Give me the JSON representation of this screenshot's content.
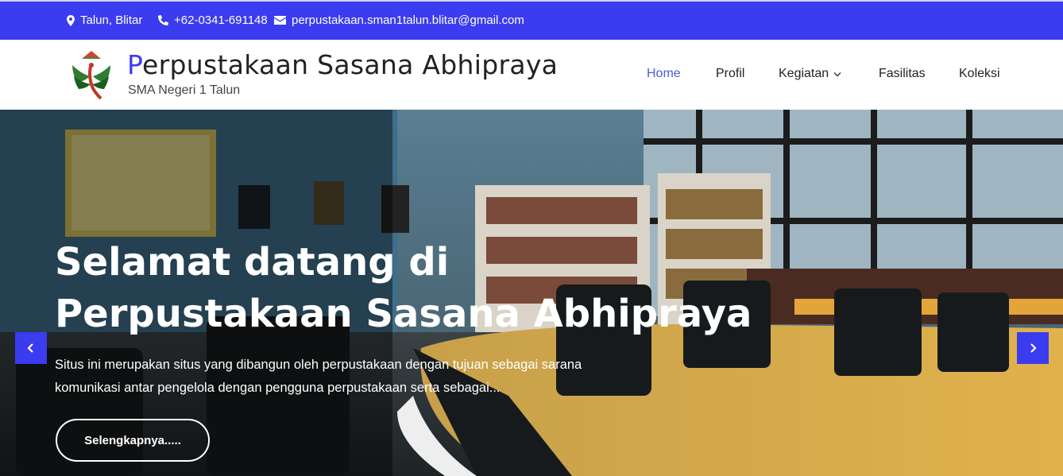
{
  "topbar": {
    "location": "Talun, Blitar",
    "phone": "+62-0341-691148",
    "email": "perpustakaan.sman1talun.blitar@gmail.com"
  },
  "brand": {
    "title_first_letter": "P",
    "title_rest": "erpustakaan Sasana Abhipraya",
    "subtitle": "SMA Negeri 1 Talun"
  },
  "nav": {
    "items": [
      {
        "label": "Home",
        "active": true
      },
      {
        "label": "Profil"
      },
      {
        "label": "Kegiatan",
        "dropdown": true
      },
      {
        "label": "Fasilitas"
      },
      {
        "label": "Koleksi"
      }
    ]
  },
  "hero": {
    "title_line1": "Selamat datang di",
    "title_line2": "Perpustakaan Sasana Abhipraya",
    "text_line1": "Situs ini merupakan situs yang dibangun oleh perpustakaan dengan tujuan sebagai sarana",
    "text_line2": "komunikasi antar pengelola dengan pengguna perpustakaan serta sebagai...",
    "button_label": "Selengkapnya....."
  },
  "colors": {
    "primary": "#3b3bf0",
    "nav_active": "#4b5ad8"
  }
}
